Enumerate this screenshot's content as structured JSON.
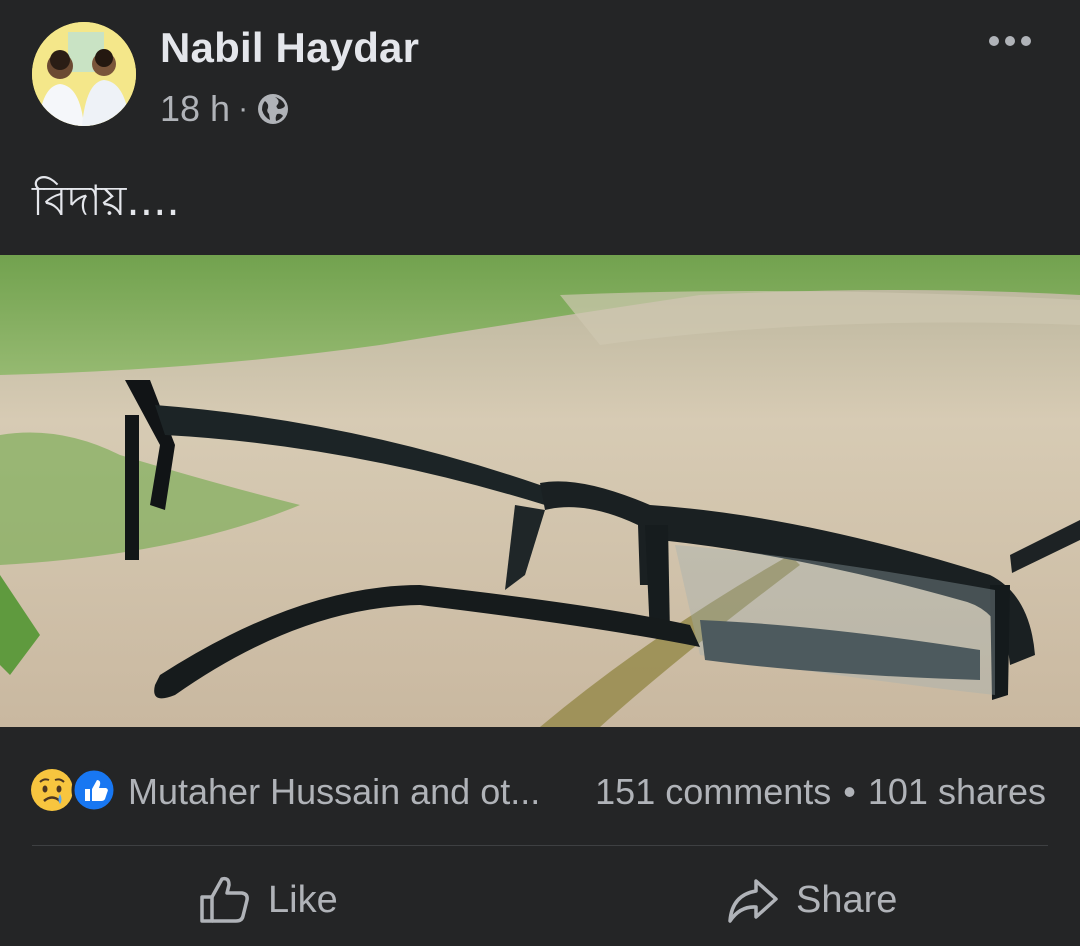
{
  "post": {
    "author": "Nabil Haydar",
    "time": "18 h",
    "separator": "·",
    "privacy_icon": "globe-icon",
    "more_icon": "more-options-icon",
    "text": "বিদায়...."
  },
  "photo": {
    "subject": "broken-eyeglasses-on-sand"
  },
  "stats": {
    "reaction_icons": [
      "sad-reaction-icon",
      "like-reaction-icon"
    ],
    "reactors": "Mutaher Hussain and ot...",
    "comments": "151 comments",
    "separator": "•",
    "shares": "101 shares"
  },
  "actions": {
    "like_label": "Like",
    "share_label": "Share"
  },
  "colors": {
    "background": "#242526",
    "primary_text": "#e4e6eb",
    "secondary_text": "#b0b3b8",
    "like_blue": "#1877f2"
  }
}
